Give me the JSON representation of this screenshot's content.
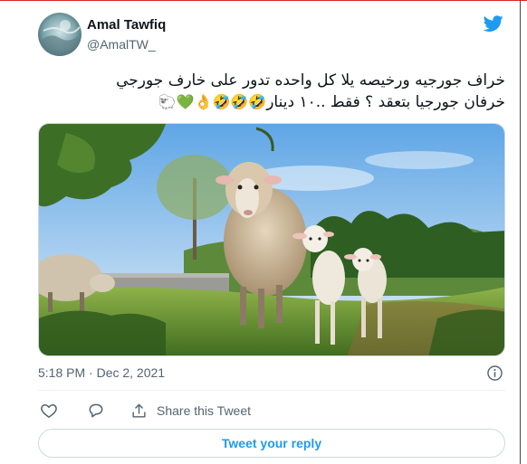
{
  "tweet": {
    "author_name": "Amal Tawfiq",
    "author_handle": "@AmalTW_",
    "text_line1": "خراف جورجيه ورخيصه يلا كل واحده تدور على خارف جورجي",
    "text_line2": "خرفان جورجيا بتعقد ؟ فقط ..١٠ دينار",
    "emojis": "🐑💚👌🤣🤣🤣",
    "timestamp": "5:18 PM · Dec 2, 2021",
    "image_icon": "sheep-photo"
  },
  "actions": {
    "like_icon": "heart-icon",
    "reply_icon": "reply-icon",
    "share_label": "Share this Tweet",
    "reply_button_label": "Tweet your reply"
  },
  "colors": {
    "accent": "#1d9bf0",
    "text": "#0f1419",
    "muted": "#536471",
    "border": "#cfd9de"
  }
}
